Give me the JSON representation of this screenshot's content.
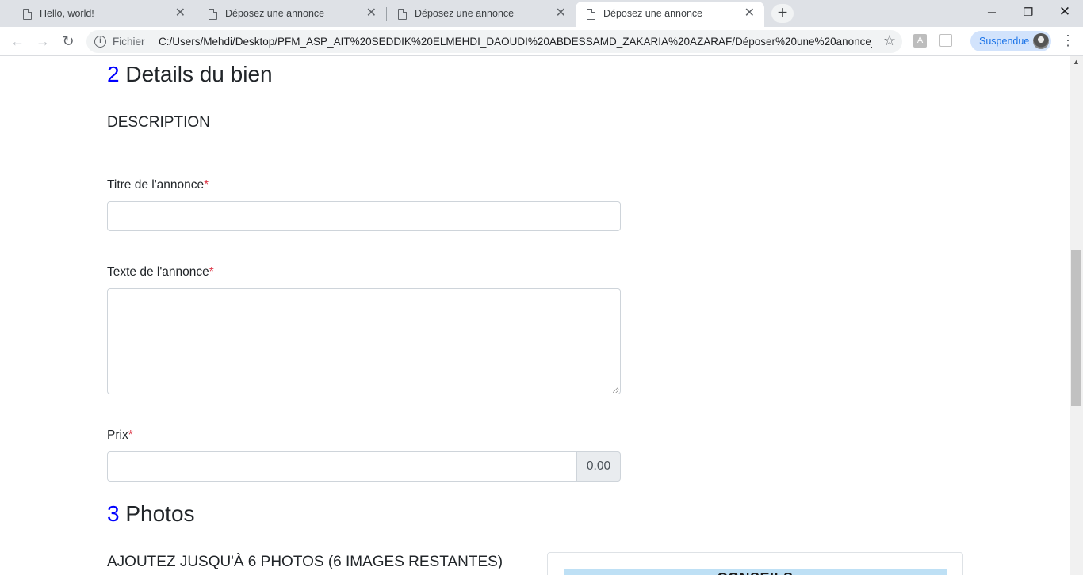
{
  "browser": {
    "tabs": [
      {
        "title": "Hello, world!",
        "active": false
      },
      {
        "title": "Déposez une annonce",
        "active": false
      },
      {
        "title": "Déposez une annonce",
        "active": false
      },
      {
        "title": "Déposez une annonce",
        "active": true
      }
    ],
    "new_tab_label": "+",
    "window_controls": {
      "minimize": "─",
      "restore": "❐",
      "close": "✕"
    },
    "address": {
      "scheme_label": "Fichier",
      "url": "C:/Users/Mehdi/Desktop/PFM_ASP_AIT%20SEDDIK%20ELMEHDI_DAOUDI%20ABDESSAMD_ZAKARIA%20AZARAF/Déposer%20une%20anonce_..."
    },
    "profile_label": "Suspendue",
    "icons": [
      "back-icon",
      "forward-icon",
      "reload-icon",
      "info-icon",
      "star-icon",
      "pdf-extension-icon",
      "extension-icon",
      "avatar",
      "menu-icon"
    ]
  },
  "page": {
    "section2": {
      "number": "2",
      "title": "Details du bien"
    },
    "description_heading": "DESCRIPTION",
    "fields": {
      "titre": {
        "label": "Titre de l'annonce",
        "required_mark": "*",
        "value": ""
      },
      "texte": {
        "label": "Texte de l'annonce",
        "required_mark": "*",
        "value": ""
      },
      "prix": {
        "label": "Prix",
        "required_mark": "*",
        "value": "",
        "addon": "0.00"
      }
    },
    "section3": {
      "number": "3",
      "title": "Photos"
    },
    "photos_heading": "AJOUTEZ JUSQU'À 6 PHOTOS (6 IMAGES RESTANTES)",
    "conseils_title": "CONSEILS"
  }
}
